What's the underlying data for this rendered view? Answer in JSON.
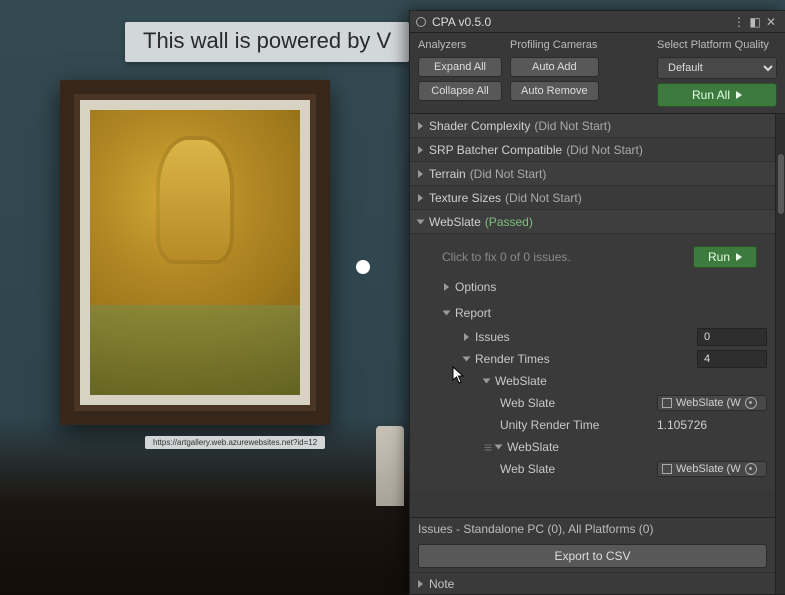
{
  "scene": {
    "banner_text": "This wall is powered by V",
    "url_tag": "https://artgallery.web.azurewebsites.net?id=12"
  },
  "panel": {
    "title": "CPA v0.5.0",
    "analyzers_label": "Analyzers",
    "profiling_cameras_label": "Profiling Cameras",
    "platform_quality_label": "Select Platform Quality",
    "default_option": "Default",
    "expand_all": "Expand All",
    "collapse_all": "Collapse All",
    "auto_add": "Auto Add",
    "auto_remove": "Auto Remove",
    "run_all": "Run All",
    "analyzers": [
      {
        "name": "Shader Complexity",
        "status": "(Did Not Start)"
      },
      {
        "name": "SRP Batcher Compatible",
        "status": "(Did Not Start)"
      },
      {
        "name": "Terrain",
        "status": "(Did Not Start)"
      },
      {
        "name": "Texture Sizes",
        "status": "(Did Not Start)"
      }
    ],
    "webslate": {
      "name": "WebSlate",
      "status": "(Passed)",
      "fix_hint": "Click to fix 0 of 0 issues.",
      "run_label": "Run",
      "options_label": "Options",
      "report_label": "Report",
      "issues_label": "Issues",
      "issues_count": "0",
      "render_times_label": "Render Times",
      "render_times_count": "4",
      "entries": [
        {
          "group": "WebSlate",
          "slate_label": "Web Slate",
          "slate_obj": "WebSlate (W",
          "time_label": "Unity Render Time",
          "time_value": "1.105726"
        },
        {
          "group": "WebSlate",
          "slate_label": "Web Slate",
          "slate_obj": "WebSlate (W"
        }
      ]
    },
    "footer": {
      "issues_line_prefix": "Issues - Standalone PC (",
      "issues_pc": "0",
      "issues_mid": "), All Platforms (",
      "issues_all": "0",
      "issues_suffix": ")",
      "export_label": "Export to CSV",
      "note_label": "Note"
    }
  }
}
